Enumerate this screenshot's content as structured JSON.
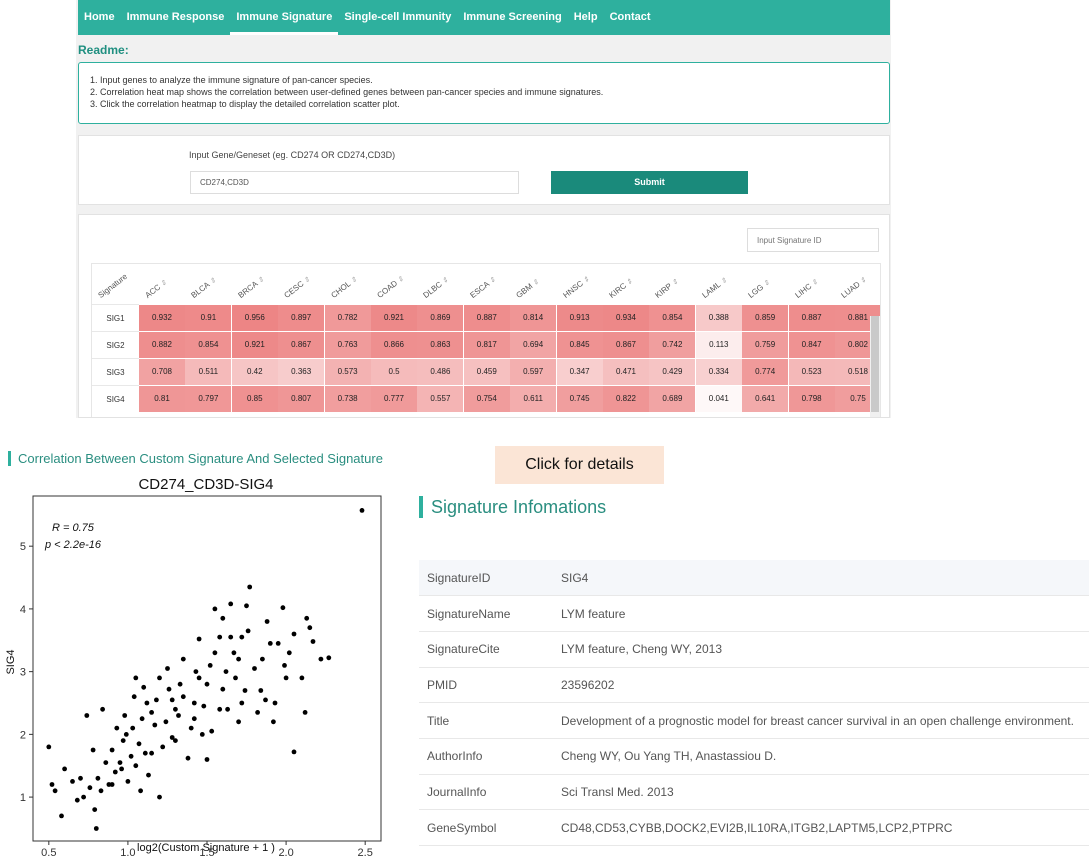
{
  "nav": {
    "items": [
      "Home",
      "Immune Response",
      "Immune Signature",
      "Single-cell Immunity",
      "Immune Screening",
      "Help",
      "Contact"
    ],
    "active": "Immune Signature"
  },
  "readme": {
    "title": "Readme:",
    "lines": [
      "1. Input genes to analyze the immune signature of pan-cancer species.",
      "2. Correlation heat map shows the correlation between user-defined genes between pan-cancer species and immune signatures.",
      "3. Click the correlation heatmap to display the detailed correlation scatter plot."
    ]
  },
  "input": {
    "label": "Input Gene/Geneset (eg. CD274 OR CD274,CD3D)",
    "value": "CD274,CD3D",
    "submit": "Submit"
  },
  "heatmap": {
    "search_placeholder": "Input Signature ID",
    "corner_label": "Signature",
    "sort_glyph": "⇕",
    "columns": [
      "ACC",
      "BLCA",
      "BRCA",
      "CESC",
      "CHOL",
      "COAD",
      "DLBC",
      "ESCA",
      "GBM",
      "HNSC",
      "KIRC",
      "KIRP",
      "LAML",
      "LGG",
      "LIHC",
      "LUAD"
    ],
    "rows": [
      {
        "label": "SIG1",
        "values": [
          "0.932",
          "0.91",
          "0.956",
          "0.897",
          "0.782",
          "0.921",
          "0.869",
          "0.887",
          "0.814",
          "0.913",
          "0.934",
          "0.854",
          "0.388",
          "0.859",
          "0.887",
          "0.881"
        ]
      },
      {
        "label": "SIG2",
        "values": [
          "0.882",
          "0.854",
          "0.921",
          "0.867",
          "0.763",
          "0.866",
          "0.863",
          "0.817",
          "0.694",
          "0.845",
          "0.867",
          "0.742",
          "0.113",
          "0.759",
          "0.847",
          "0.802"
        ]
      },
      {
        "label": "SIG3",
        "values": [
          "0.708",
          "0.511",
          "0.42",
          "0.363",
          "0.573",
          "0.5",
          "0.486",
          "0.459",
          "0.597",
          "0.347",
          "0.471",
          "0.429",
          "0.334",
          "0.774",
          "0.523",
          "0.518"
        ]
      },
      {
        "label": "SIG4",
        "values": [
          "0.81",
          "0.797",
          "0.85",
          "0.807",
          "0.738",
          "0.777",
          "0.557",
          "0.754",
          "0.611",
          "0.745",
          "0.822",
          "0.689",
          "0.041",
          "0.641",
          "0.798",
          "0.75"
        ]
      }
    ]
  },
  "correlation": {
    "section_title": "Correlation Between Custom Signature And Selected Signature",
    "details_button": "Click for details"
  },
  "chart_data": {
    "type": "scatter",
    "title": "CD274_CD3D-SIG4",
    "xlabel": "log2(Custom Signature + 1 )",
    "ylabel": "SIG4",
    "xlim": [
      0.4,
      2.6
    ],
    "ylim": [
      0.3,
      5.8
    ],
    "xticks": [
      "0.5",
      "1.0",
      "1.5",
      "2.0",
      "2.5"
    ],
    "yticks": [
      "1",
      "2",
      "3",
      "4",
      "5"
    ],
    "annotation_r": "R = 0.75",
    "annotation_p": "p < 2.2e-16",
    "point_color": "#000000",
    "points": [
      [
        2.48,
        5.57
      ],
      [
        2.22,
        3.2
      ],
      [
        2.27,
        3.22
      ],
      [
        2.15,
        3.7
      ],
      [
        2.17,
        3.48
      ],
      [
        2.13,
        3.85
      ],
      [
        2.05,
        3.6
      ],
      [
        2.1,
        2.9
      ],
      [
        2.12,
        2.35
      ],
      [
        2.05,
        1.72
      ],
      [
        1.98,
        4.02
      ],
      [
        1.95,
        3.45
      ],
      [
        1.99,
        3.1
      ],
      [
        2.0,
        2.9
      ],
      [
        1.93,
        2.5
      ],
      [
        1.92,
        2.2
      ],
      [
        1.88,
        3.8
      ],
      [
        1.85,
        3.2
      ],
      [
        1.84,
        2.7
      ],
      [
        1.82,
        2.35
      ],
      [
        1.77,
        4.35
      ],
      [
        1.75,
        4.05
      ],
      [
        1.72,
        3.55
      ],
      [
        1.7,
        3.2
      ],
      [
        1.72,
        2.5
      ],
      [
        1.7,
        2.2
      ],
      [
        1.65,
        4.08
      ],
      [
        1.65,
        3.55
      ],
      [
        1.62,
        3.0
      ],
      [
        1.6,
        2.72
      ],
      [
        1.58,
        2.4
      ],
      [
        1.55,
        4.0
      ],
      [
        1.55,
        3.3
      ],
      [
        1.52,
        3.1
      ],
      [
        1.5,
        2.8
      ],
      [
        1.48,
        2.45
      ],
      [
        1.47,
        2.0
      ],
      [
        1.45,
        3.52
      ],
      [
        1.43,
        3.0
      ],
      [
        1.42,
        2.5
      ],
      [
        1.4,
        2.1
      ],
      [
        1.38,
        1.62
      ],
      [
        1.35,
        3.2
      ],
      [
        1.33,
        2.8
      ],
      [
        1.32,
        2.3
      ],
      [
        1.3,
        1.9
      ],
      [
        1.28,
        2.55
      ],
      [
        1.26,
        2.72
      ],
      [
        1.24,
        2.2
      ],
      [
        1.22,
        1.8
      ],
      [
        1.2,
        2.9
      ],
      [
        1.18,
        2.55
      ],
      [
        1.17,
        2.15
      ],
      [
        1.15,
        1.7
      ],
      [
        1.13,
        1.35
      ],
      [
        1.12,
        2.5
      ],
      [
        1.1,
        2.75
      ],
      [
        1.09,
        2.25
      ],
      [
        1.07,
        1.85
      ],
      [
        1.05,
        1.5
      ],
      [
        1.04,
        2.6
      ],
      [
        1.03,
        2.1
      ],
      [
        1.02,
        1.65
      ],
      [
        1.0,
        1.25
      ],
      [
        0.98,
        2.3
      ],
      [
        0.97,
        1.9
      ],
      [
        0.95,
        1.55
      ],
      [
        0.93,
        2.1
      ],
      [
        0.92,
        1.4
      ],
      [
        0.9,
        1.75
      ],
      [
        0.88,
        1.2
      ],
      [
        0.86,
        1.55
      ],
      [
        0.84,
        2.4
      ],
      [
        0.83,
        1.1
      ],
      [
        0.81,
        1.3
      ],
      [
        0.79,
        0.8
      ],
      [
        0.78,
        1.75
      ],
      [
        0.76,
        1.15
      ],
      [
        0.74,
        2.3
      ],
      [
        0.72,
        1.0
      ],
      [
        0.7,
        1.3
      ],
      [
        0.68,
        0.95
      ],
      [
        0.65,
        1.25
      ],
      [
        0.6,
        1.45
      ],
      [
        0.58,
        0.7
      ],
      [
        0.54,
        1.1
      ],
      [
        0.52,
        1.2
      ],
      [
        0.5,
        1.8
      ],
      [
        0.8,
        0.5
      ],
      [
        1.45,
        2.9
      ],
      [
        1.58,
        3.55
      ],
      [
        1.8,
        3.05
      ],
      [
        1.68,
        2.9
      ],
      [
        1.35,
        2.6
      ],
      [
        1.25,
        3.05
      ],
      [
        1.15,
        2.35
      ],
      [
        1.08,
        1.1
      ],
      [
        0.96,
        1.45
      ],
      [
        1.6,
        3.85
      ],
      [
        1.87,
        2.55
      ],
      [
        2.02,
        3.3
      ],
      [
        1.76,
        3.65
      ],
      [
        1.28,
        1.95
      ],
      [
        1.42,
        2.25
      ],
      [
        0.99,
        2.0
      ],
      [
        1.53,
        2.05
      ],
      [
        1.63,
        2.4
      ],
      [
        1.74,
        2.7
      ],
      [
        1.9,
        3.45
      ],
      [
        1.11,
        1.7
      ],
      [
        0.9,
        1.2
      ],
      [
        1.3,
        2.4
      ],
      [
        1.05,
        2.9
      ],
      [
        1.5,
        1.6
      ],
      [
        1.67,
        3.3
      ],
      [
        1.2,
        1.0
      ]
    ]
  },
  "signature_info": {
    "title": "Signature Infomations",
    "rows": [
      {
        "key": "SignatureID",
        "value": "SIG4"
      },
      {
        "key": "SignatureName",
        "value": "LYM feature"
      },
      {
        "key": "SignatureCite",
        "value": "LYM feature, Cheng WY, 2013"
      },
      {
        "key": "PMID",
        "value": "23596202"
      },
      {
        "key": "Title",
        "value": "Development of a prognostic model for breast cancer survival in an open challenge environment."
      },
      {
        "key": "AuthorInfo",
        "value": "Cheng WY, Ou Yang TH, Anastassiou D."
      },
      {
        "key": "JournalInfo",
        "value": "Sci Transl Med. 2013"
      },
      {
        "key": "GeneSymbol",
        "value": "CD48,CD53,CYBB,DOCK2,EVI2B,IL10RA,ITGB2,LAPTM5,LCP2,PTPRC"
      }
    ]
  }
}
